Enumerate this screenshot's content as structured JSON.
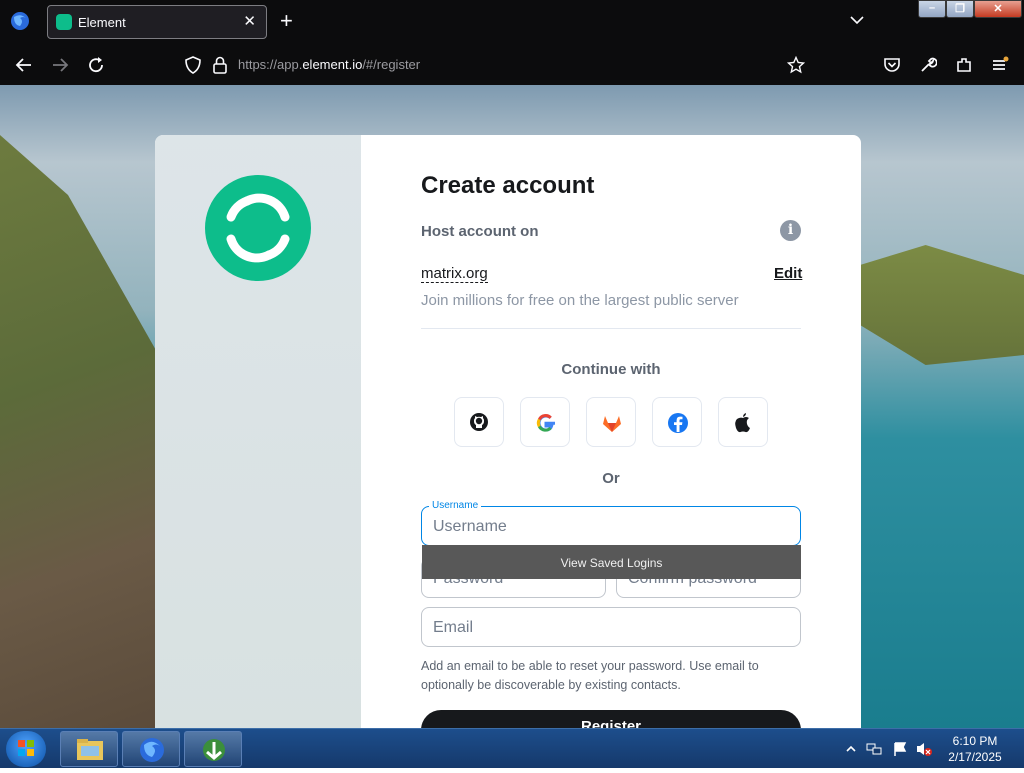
{
  "browser": {
    "tab_title": "Element",
    "url_prefix": "https://app.",
    "url_domain": "element.io",
    "url_suffix": "/#/register"
  },
  "page": {
    "heading": "Create account",
    "host_label": "Host account on",
    "server_name": "matrix.org",
    "edit_label": "Edit",
    "server_description": "Join millions for free on the largest public server",
    "continue_with": "Continue with",
    "sso_providers": [
      "github-icon",
      "google-icon",
      "gitlab-icon",
      "facebook-icon",
      "apple-icon"
    ],
    "or_label": "Or",
    "username_label": "Username",
    "username_placeholder": "Username",
    "password_placeholder": "Password",
    "confirm_password_placeholder": "Confirm password",
    "email_placeholder": "Email",
    "saved_logins": "View Saved Logins",
    "email_help": "Add an email to be able to reset your password. Use email to optionally be discoverable by existing contacts.",
    "register_label": "Register",
    "accent_color": "#0dbd8b"
  },
  "taskbar": {
    "time": "6:10 PM",
    "date": "2/17/2025"
  }
}
